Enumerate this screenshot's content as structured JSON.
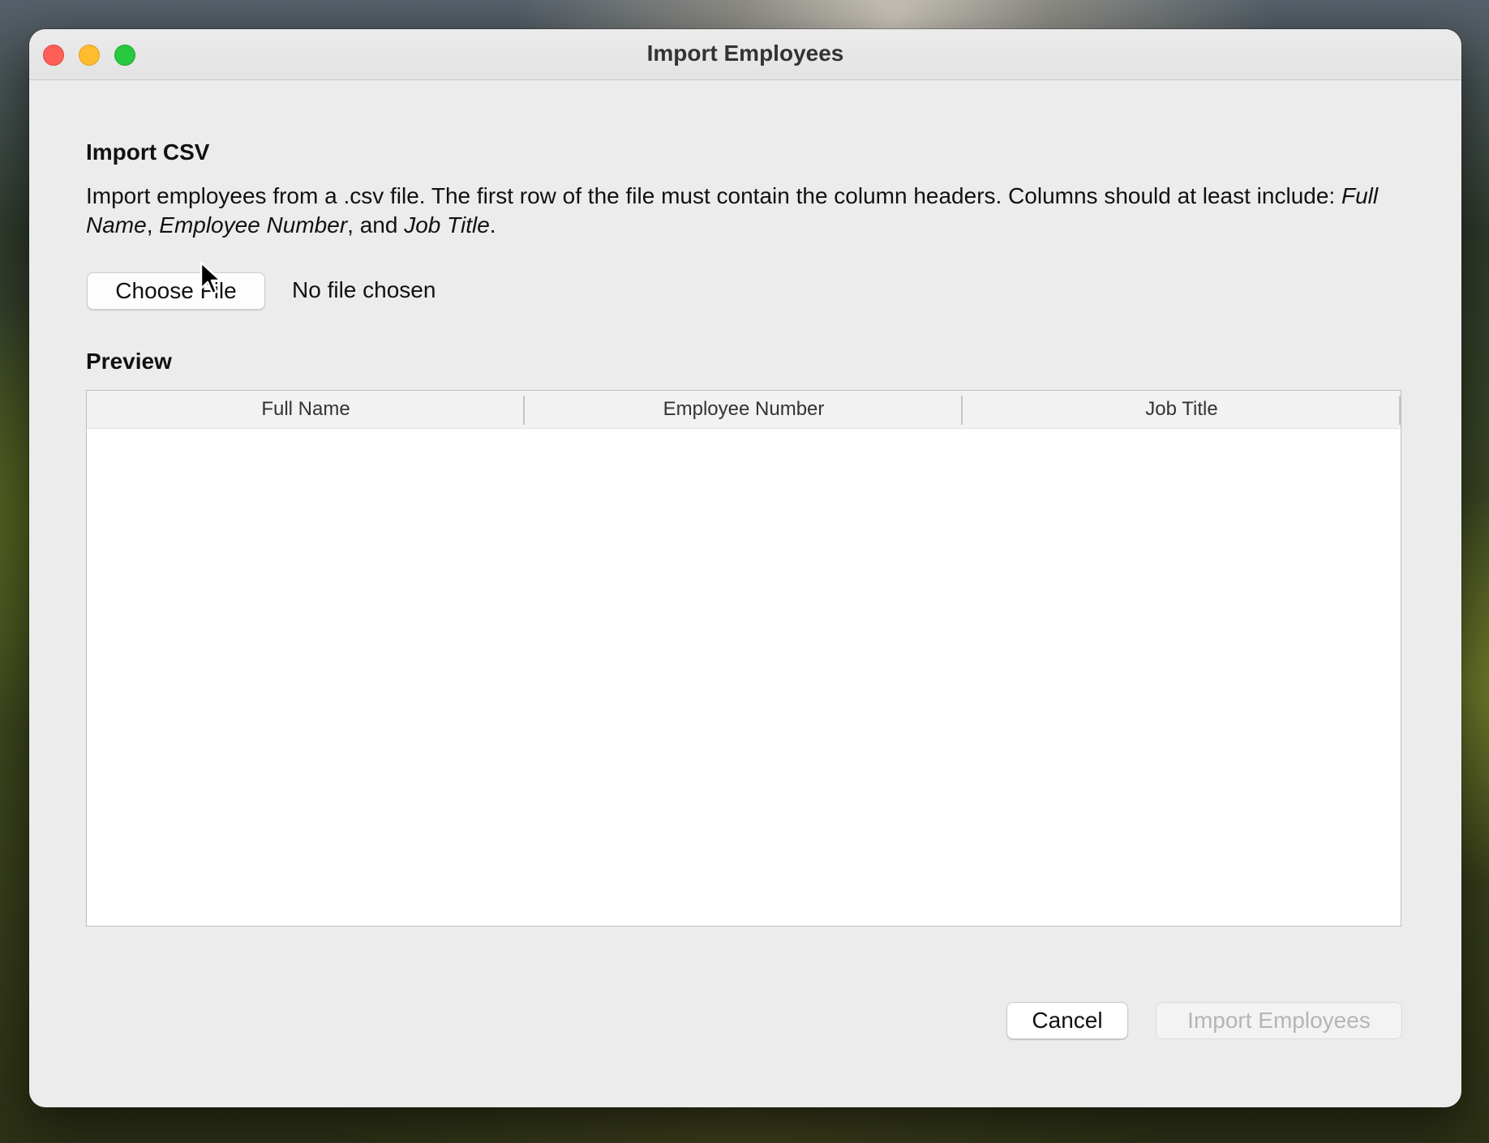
{
  "window": {
    "title": "Import Employees"
  },
  "import_section": {
    "heading": "Import CSV",
    "description_prefix": "Import employees from a .csv file. The first row of the file must contain the column headers. Columns should at least include: ",
    "required_columns": [
      "Full Name",
      "Employee Number",
      "Job Title"
    ],
    "separator_1": ", ",
    "separator_2": ", and ",
    "description_suffix": ".",
    "choose_file_label": "Choose File",
    "file_status": "No file chosen"
  },
  "preview": {
    "heading": "Preview",
    "columns": [
      "Full Name",
      "Employee Number",
      "Job Title"
    ],
    "rows": []
  },
  "footer": {
    "cancel_label": "Cancel",
    "import_label": "Import Employees",
    "import_enabled": false
  },
  "colors": {
    "close": "#fe5f57",
    "minimize": "#febc2e",
    "maximize": "#28c840",
    "window_bg": "#ececec",
    "disabled_text": "#b5b5b5"
  }
}
